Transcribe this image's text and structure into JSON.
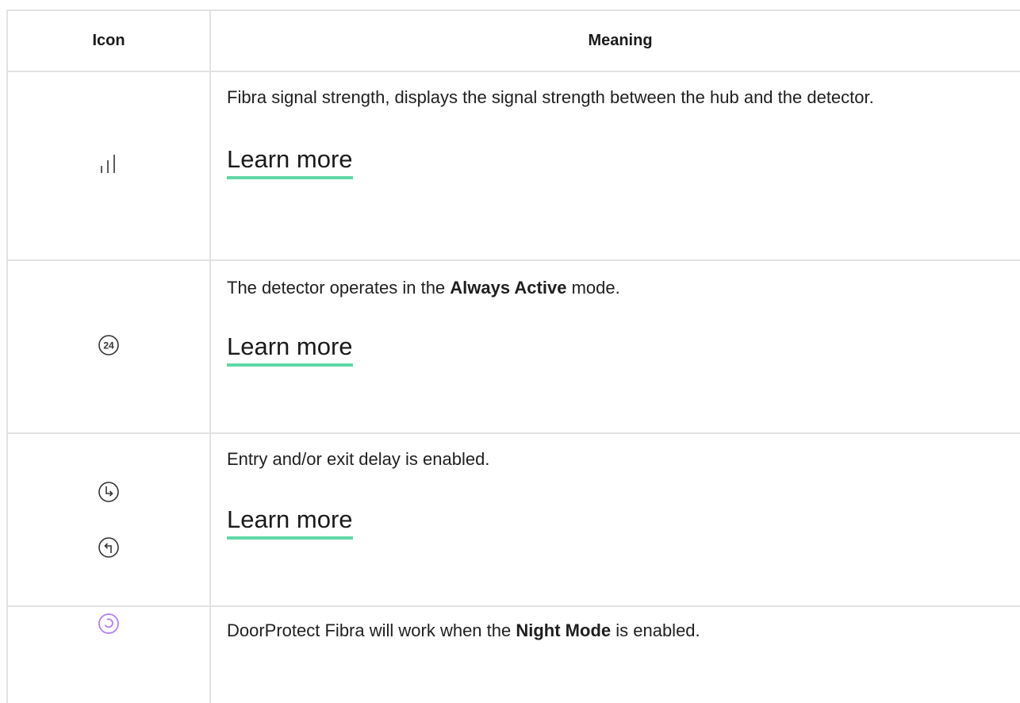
{
  "table": {
    "headers": {
      "icon": "Icon",
      "meaning": "Meaning"
    },
    "rows": [
      {
        "icons": [
          "signal-strength-icon"
        ],
        "text": "Fibra signal strength, displays the signal strength between the hub and the detector.",
        "link": "Learn more"
      },
      {
        "icons": [
          "always-active-24-icon"
        ],
        "text_before": "The detector operates in the ",
        "text_bold": "Always Active",
        "text_after": " mode.",
        "icon_label": "24",
        "link": "Learn more"
      },
      {
        "icons": [
          "entry-delay-icon",
          "exit-delay-icon"
        ],
        "text": "Entry and/or exit delay is enabled.",
        "link": "Learn more"
      },
      {
        "icons": [
          "night-mode-icon"
        ],
        "text_before": "DoorProtect Fibra will work when the ",
        "text_bold": "Night Mode",
        "text_after": " is enabled."
      }
    ]
  },
  "colors": {
    "border": "#e2e2e2",
    "link_underline": "#5ed9a6",
    "night_mode_icon": "#b57cf5",
    "text": "#1f1f1f"
  }
}
